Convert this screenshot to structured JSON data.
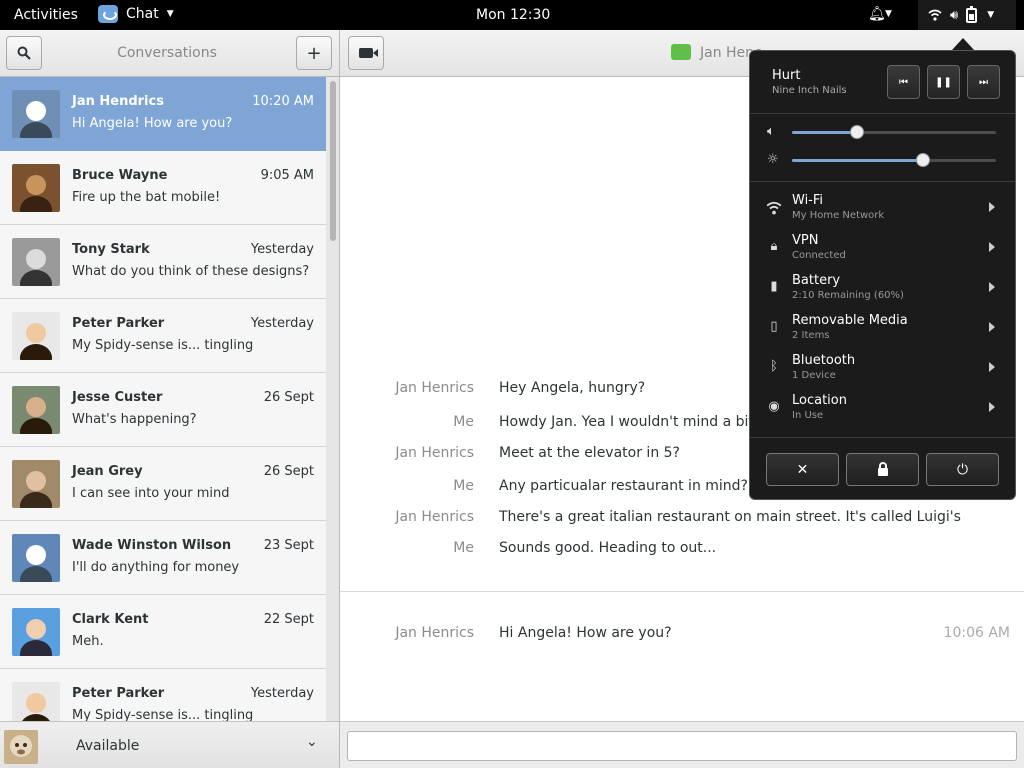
{
  "topbar": {
    "activities": "Activities",
    "app_name": "Chat",
    "clock": "Mon 12:30"
  },
  "conversations": {
    "title": "Conversations",
    "items": [
      {
        "name": "Jan Hendrics",
        "time": "10:20 AM",
        "message": "Hi Angela! How are you?",
        "selected": true
      },
      {
        "name": "Bruce Wayne",
        "time": "9:05 AM",
        "message": "Fire up the bat mobile!"
      },
      {
        "name": "Tony Stark",
        "time": "Yesterday",
        "message": "What do you think of these designs?"
      },
      {
        "name": "Peter Parker",
        "time": "Yesterday",
        "message": "My Spidy-sense is... tingling"
      },
      {
        "name": "Jesse Custer",
        "time": "26 Sept",
        "message": "What's happening?"
      },
      {
        "name": "Jean Grey",
        "time": "26 Sept",
        "message": "I can see into your mind"
      },
      {
        "name": "Wade Winston Wilson",
        "time": "23 Sept",
        "message": "I'll do anything for money"
      },
      {
        "name": "Clark Kent",
        "time": "22 Sept",
        "message": "Meh."
      },
      {
        "name": "Peter Parker",
        "time": "Yesterday",
        "message": "My Spidy-sense is... tingling"
      }
    ]
  },
  "status": {
    "label": "Available"
  },
  "chat": {
    "contact": "Jan Henc",
    "messages": [
      {
        "sender": "Jan Henrics",
        "text": "Hey Angela, hungry?"
      },
      {
        "sender": "Me",
        "text": "Howdy Jan. Yea I wouldn't mind a bite."
      },
      {
        "sender": "Jan Henrics",
        "text": "Meet at the elevator in 5?"
      },
      {
        "sender": "Me",
        "text": "Any particualar restaurant in mind?"
      },
      {
        "sender": "Jan Henrics",
        "text": "There's a great italian restaurant on main street. It's called Luigi's"
      },
      {
        "sender": "Me",
        "text": "Sounds good. Heading to out..."
      }
    ],
    "last": {
      "sender": "Jan Henrics",
      "text": "Hi Angela! How are you?",
      "time": "10:06 AM"
    },
    "input_value": ""
  },
  "sysmenu": {
    "media": {
      "title": "Hurt",
      "artist": "Nine Inch Nails"
    },
    "volume_level": 0.32,
    "brightness_level": 0.64,
    "items": [
      {
        "label": "Wi-Fi",
        "sub": "My Home Network"
      },
      {
        "label": "VPN",
        "sub": "Connected"
      },
      {
        "label": "Battery",
        "sub": "2:10 Remaining (60%)"
      },
      {
        "label": "Removable Media",
        "sub": "2 Items"
      },
      {
        "label": "Bluetooth",
        "sub": "1 Device"
      },
      {
        "label": "Location",
        "sub": "In Use"
      }
    ]
  },
  "colors": {
    "selection": "#7fa5d6",
    "slider_fill": "#7ea6d6",
    "menu_bg": "#1b1b1b"
  }
}
